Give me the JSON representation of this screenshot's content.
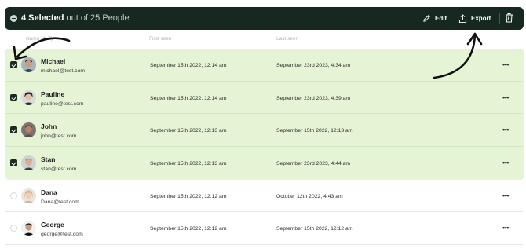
{
  "toolbar": {
    "selected_count": "4 Selected",
    "selected_suffix": "out of 25 People",
    "edit_label": "Edit",
    "export_label": "Export",
    "bg_color": "#16281f"
  },
  "columns": {
    "name": "Name (A-Z)",
    "first_seen": "First seen",
    "last_seen": "Last seen"
  },
  "rows": [
    {
      "name": "Michael",
      "email": "michael@test.com",
      "first_seen": "September 15th 2022, 12:14 am",
      "last_seen": "September 23rd 2023, 4:34 am",
      "selected": true
    },
    {
      "name": "Pauline",
      "email": "pauline@test.com",
      "first_seen": "September 15th 2022, 12:14 am",
      "last_seen": "September 23rd 2023, 4:39 am",
      "selected": true
    },
    {
      "name": "John",
      "email": "john@test.com",
      "first_seen": "September 15th 2022, 12:13 am",
      "last_seen": "September 15th 2022, 12:13 am",
      "selected": true
    },
    {
      "name": "Stan",
      "email": "stan@test.com",
      "first_seen": "September 15th 2022, 12:13 am",
      "last_seen": "September 23rd 2023, 4:44 am",
      "selected": true
    },
    {
      "name": "Dana",
      "email": "Dana@test.com",
      "first_seen": "September 15th 2022, 12:12 am",
      "last_seen": "October 12th 2022, 4:43 am",
      "selected": false
    },
    {
      "name": "George",
      "email": "george@test.com",
      "first_seen": "September 15th 2022, 12:12 am",
      "last_seen": "September 15th 2022, 12:12 am",
      "selected": false
    }
  ],
  "more_label": "•••",
  "selected_row_color": "#e4f4d4"
}
